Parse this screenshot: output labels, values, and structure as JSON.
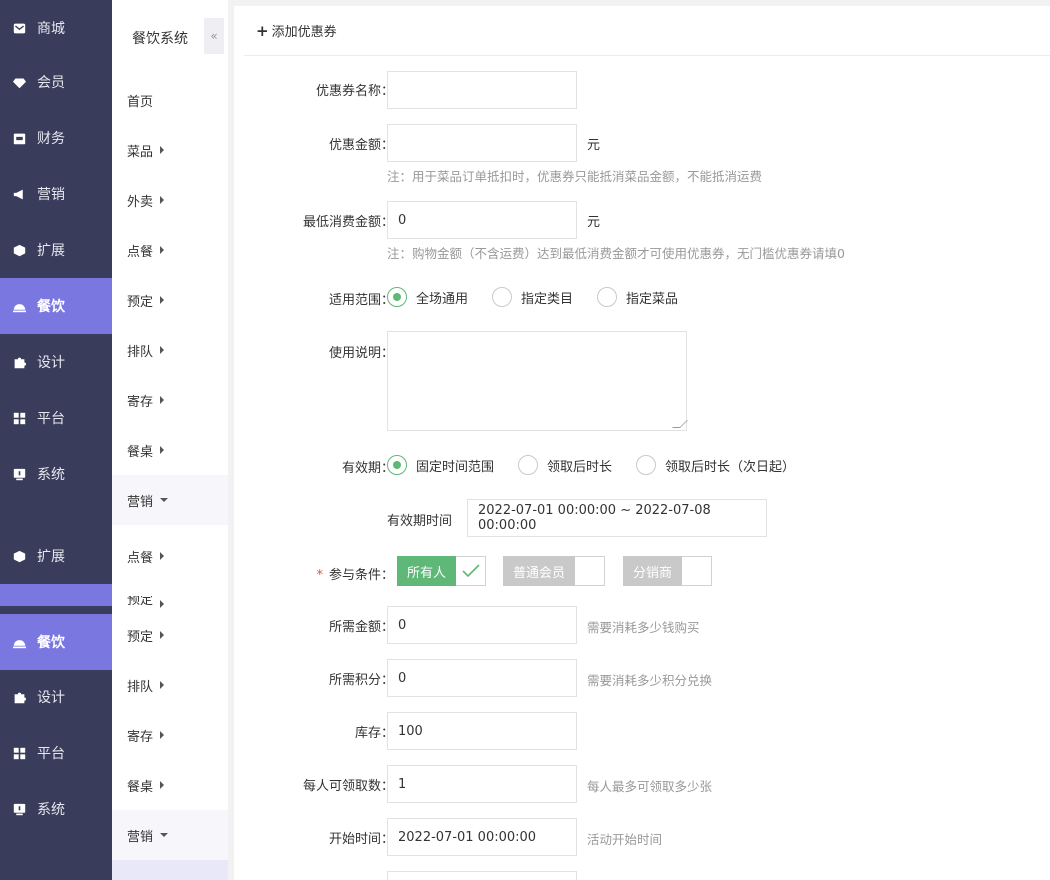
{
  "nav_primary": [
    {
      "label": "商城",
      "icon": "mail-icon"
    },
    {
      "label": "会员",
      "icon": "diamond-icon"
    },
    {
      "label": "财务",
      "icon": "wallet-icon"
    },
    {
      "label": "营销",
      "icon": "megaphone-icon"
    },
    {
      "label": "扩展",
      "icon": "cube-icon"
    },
    {
      "label": "餐饮",
      "icon": "cloche-icon"
    },
    {
      "label": "设计",
      "icon": "puzzle-icon"
    },
    {
      "label": "平台",
      "icon": "grid-icon"
    },
    {
      "label": "系统",
      "icon": "monitor-icon"
    },
    {
      "label": "扩展",
      "icon": "cube-icon"
    },
    {
      "label": "餐饮",
      "icon": "cloche-icon"
    },
    {
      "label": "设计",
      "icon": "puzzle-icon"
    },
    {
      "label": "平台",
      "icon": "grid-icon"
    },
    {
      "label": "系统",
      "icon": "monitor-icon"
    }
  ],
  "nav_secondary": {
    "title": "餐饮系统",
    "collapse": "«",
    "items": [
      "首页",
      "菜品",
      "外卖",
      "点餐",
      "预定",
      "排队",
      "寄存",
      "餐桌",
      "营销",
      "点餐",
      "预定",
      "预定",
      "排队",
      "寄存",
      "餐桌",
      "营销"
    ]
  },
  "panel": {
    "add_label": "添加优惠券"
  },
  "form": {
    "name_label": "优惠券名称：",
    "name_value": "",
    "amount_label": "优惠金额：",
    "amount_value": "",
    "unit": "元",
    "amount_note": "注：用于菜品订单抵扣时，优惠券只能抵消菜品金额，不能抵消运费",
    "min_label": "最低消费金额：",
    "min_value": "0",
    "min_note": "注：购物金额（不含运费）达到最低消费金额才可使用优惠券，无门槛优惠券请填0",
    "scope_label": "适用范围：",
    "scope_options": [
      "全场通用",
      "指定类目",
      "指定菜品"
    ],
    "desc_label": "使用说明：",
    "valid_label": "有效期：",
    "valid_options": [
      "固定时间范围",
      "领取后时长",
      "领取后时长（次日起）"
    ],
    "valid_time_label": "有效期时间",
    "valid_time_value": "2022-07-01 00:00:00 ~ 2022-07-08 00:00:00",
    "cond_label": "参与条件：",
    "cond_required": "*",
    "cond_options": [
      "所有人",
      "普通会员",
      "分销商"
    ],
    "cost_label": "所需金额：",
    "cost_value": "0",
    "cost_note": "需要消耗多少钱购买",
    "points_label": "所需积分：",
    "points_value": "0",
    "points_note": "需要消耗多少积分兑换",
    "stock_label": "库存：",
    "stock_value": "100",
    "limit_label": "每人可领取数：",
    "limit_value": "1",
    "limit_note": "每人最多可领取多少张",
    "start_label": "开始时间：",
    "start_value": "2022-07-01 00:00:00",
    "start_note": "活动开始时间"
  },
  "colors": {
    "sidebar": "#393d5b",
    "active": "#7a78e0",
    "green": "#5fb878",
    "disabled_tag": "#c9c9c9"
  }
}
